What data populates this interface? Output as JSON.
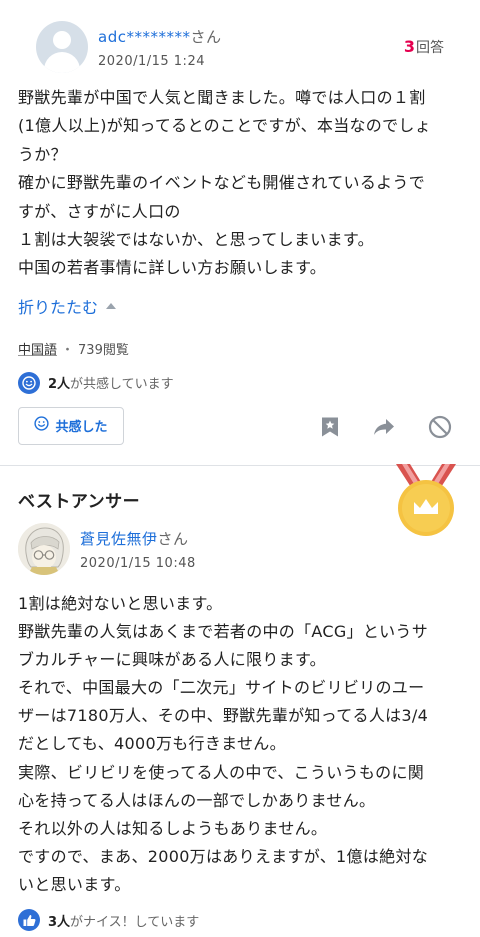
{
  "question": {
    "user_name": "adc********",
    "honorific": "さん",
    "date": "2020/1/15 1:24",
    "answer_count": "3",
    "answer_count_suffix": "回答",
    "body_lines": [
      "野獣先輩が中国で人気と聞きました。噂では人口の１割",
      "(1億人以上)が知ってるとのことですが、本当なのでしょ",
      "うか？",
      "確かに野獣先輩のイベントなども開催されているようで",
      "すが、さすがに人口の",
      "１割は大袈裟ではないか、と思ってしまいます。",
      "中国の若者事情に詳しい方お願いします。"
    ],
    "collapse_label": "折りたたむ",
    "category": "中国語",
    "separator": "・",
    "views": "739閲覧",
    "empathy_count": "2人",
    "empathy_suffix": "が共感しています",
    "empathy_button_label": "共感した"
  },
  "best_answer": {
    "title": "ベストアンサー",
    "user_name": "蒼見佐無伊",
    "honorific": "さん",
    "date": "2020/1/15 10:48",
    "body_lines": [
      "1割は絶対ないと思います。",
      "野獣先輩の人気はあくまで若者の中の「ACG」というサ",
      "ブカルチャーに興味がある人に限ります。",
      "それで、中国最大の「二次元」サイトのビリビリのユー",
      "ザーは7180万人、その中、野獣先輩が知ってる人は3/4",
      "だとしても、4000万も行きません。",
      "実際、ビリビリを使ってる人の中で、こういうものに関",
      "心を持ってる人はほんの一部でしかありません。",
      "それ以外の人は知るしようもありません。",
      "ですので、まあ、2000万はありえますが、1億は絶対な",
      "いと思います。"
    ],
    "nice_count": "3人",
    "nice_suffix": "がナイス！しています"
  },
  "colors": {
    "link": "#1e6fd9",
    "accent_red": "#e5004f",
    "badge_blue": "#2e6fd6",
    "medal_gold": "#f5c342",
    "ribbon_red": "#d9534f"
  }
}
